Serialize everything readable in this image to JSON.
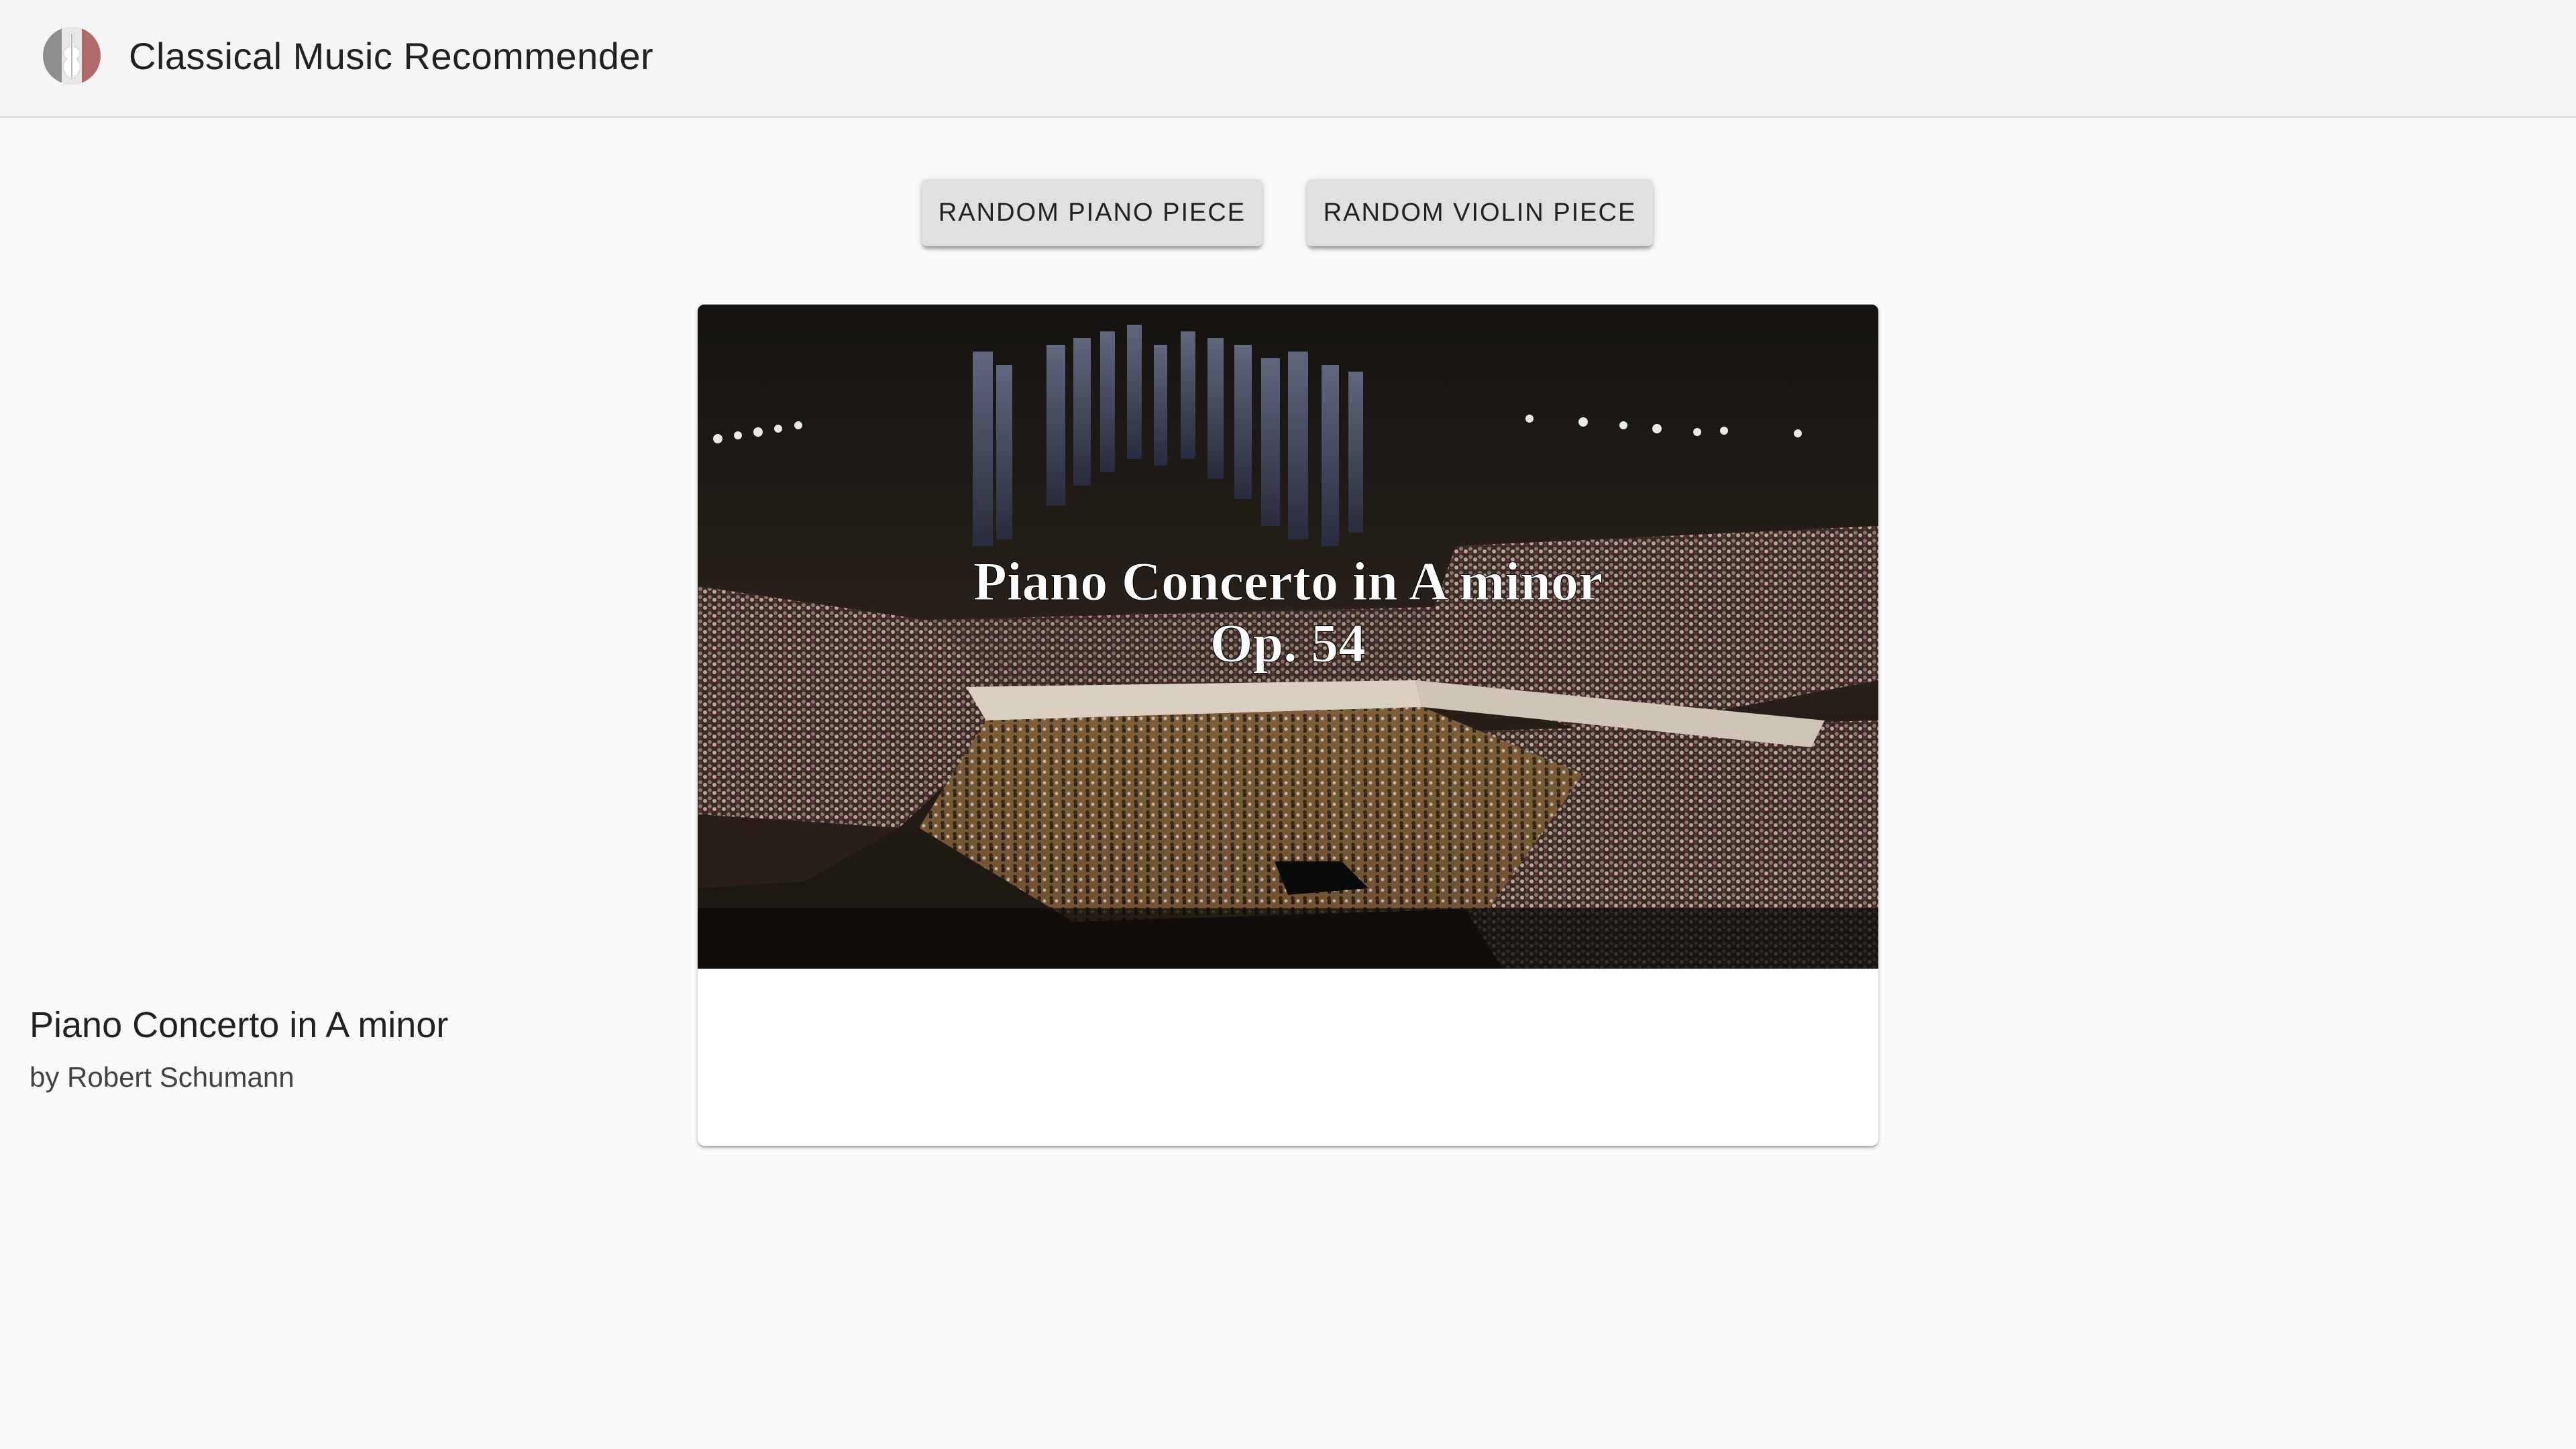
{
  "app": {
    "title": "Classical Music Recommender",
    "logo_icon": "violin-logo-icon"
  },
  "actions": {
    "piano_label": "Random Piano Piece",
    "violin_label": "Random Violin Piece"
  },
  "card": {
    "thumbnail": {
      "line1": "Piano Concerto in A minor",
      "line2": "Op. 54",
      "scene": "concert-hall-orchestra-thumbnail"
    },
    "title": "Piano Concerto in A minor",
    "subtitle": "by Robert Schumann"
  },
  "colors": {
    "app_bar": "#f5f5f5",
    "background": "#fafafa",
    "button": "#e0e0e0",
    "card": "#ffffff"
  }
}
